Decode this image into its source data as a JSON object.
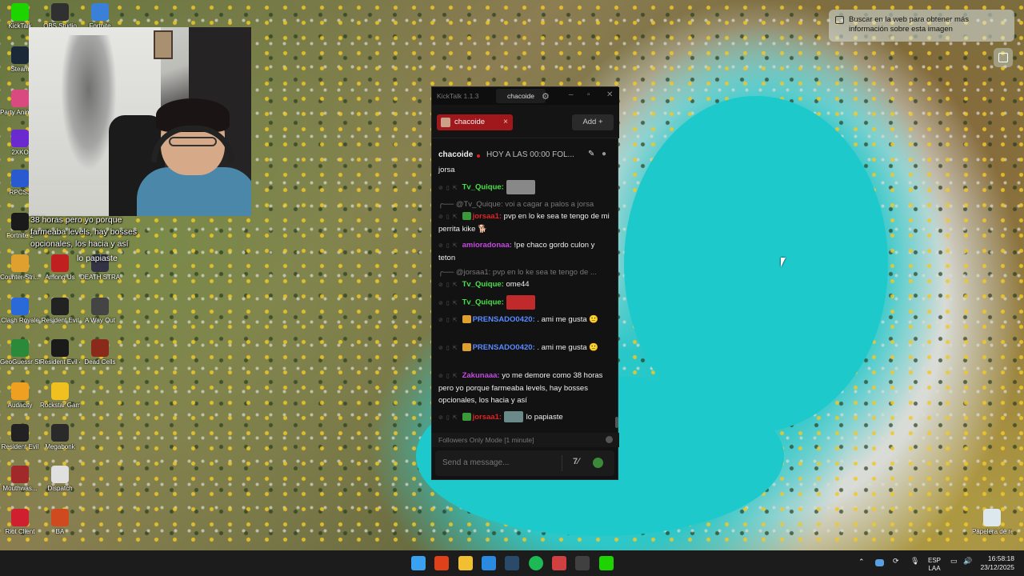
{
  "desktop": {
    "icons": [
      {
        "label": "KickTalk",
        "color": "#1ed400"
      },
      {
        "label": "OBS Studio",
        "color": "#303030"
      },
      {
        "label": "Fortnite",
        "color": "#3a7fd8"
      },
      {
        "label": "Steam",
        "color": "#1b2838"
      },
      {
        "label": "Party Anima...",
        "color": "#d84a80"
      },
      {
        "label": "2XKO",
        "color": "#6a2ad0"
      },
      {
        "label": "RPCS3",
        "color": "#2a5ad0"
      },
      {
        "label": "Fortnite 2",
        "color": "#1a1a1a"
      },
      {
        "label": "Counter-Stri...",
        "color": "#e0a030"
      },
      {
        "label": "Among Us",
        "color": "#c02020"
      },
      {
        "label": "DEATH STRANDI...",
        "color": "#333344"
      },
      {
        "label": "Clash Royale",
        "color": "#2a6ad8"
      },
      {
        "label": "Resident Evil",
        "color": "#222222"
      },
      {
        "label": "A Way Out",
        "color": "#444444"
      },
      {
        "label": "GeoGuessr Steam E...",
        "color": "#2a8a3a"
      },
      {
        "label": "Resident Evil 4",
        "color": "#1a1a1a"
      },
      {
        "label": "Dead Cells",
        "color": "#8a2a1a"
      },
      {
        "label": "Audacity",
        "color": "#f0a020"
      },
      {
        "label": "Rockstar Games...",
        "color": "#f0c020"
      },
      {
        "label": "Resident Evil",
        "color": "#222222"
      },
      {
        "label": "Megabonk",
        "color": "#2a2a2a"
      },
      {
        "label": "Mouthwas...",
        "color": "#a02a2a"
      },
      {
        "label": "Dispatch",
        "color": "#e0e0e0"
      },
      {
        "label": "Riot Client",
        "color": "#d02030"
      },
      {
        "label": "BA",
        "color": "#d04a20"
      },
      {
        "label": "Papelera de reciclaje",
        "color": "#dde8ee"
      }
    ]
  },
  "stream_overlay": {
    "caption": "38 horas pero yo porque farmeaba levels, hay bosses opcionales, los hacia y así",
    "caption2": "lo papiaste"
  },
  "lens_hint": {
    "text": "Buscar en la web para obtener más información sobre esta imagen"
  },
  "kicktalk": {
    "app_title": "KickTalk 1.1.3",
    "current_user": "chacoide",
    "tab": {
      "label": "chacoide",
      "close": "×"
    },
    "add_button": "Add",
    "channel": {
      "name": "chacoide",
      "stream_title": "HOY A LAS 00:00 FOL...",
      "pin_icon": "pin-icon",
      "users_icon": "user-icon"
    },
    "messages": [
      {
        "type": "text",
        "text": "jorsa"
      },
      {
        "type": "chat",
        "user": "Tv_Quique:",
        "user_color": "#4ae04a",
        "text": "",
        "emote": true,
        "emote_color": "#888"
      },
      {
        "type": "reply",
        "text": "@Tv_Quique: voi a cagar a palos a jorsa"
      },
      {
        "type": "chat",
        "user": "jorsaa1:",
        "user_color": "#e02424",
        "badge_color": "#3a9a3a",
        "text": "pvp en lo ke sea te tengo de mi perrita kike 🐕"
      },
      {
        "type": "chat",
        "user": "amioradonaa:",
        "user_color": "#c24ae0",
        "text": "!pe chaco gordo culon y teton"
      },
      {
        "type": "reply",
        "text": "@jorsaa1: pvp en lo ke sea te tengo de ..."
      },
      {
        "type": "chat",
        "user": "Tv_Quique:",
        "user_color": "#4ae04a",
        "text": "ome44"
      },
      {
        "type": "chat",
        "user": "Tv_Quique:",
        "user_color": "#4ae04a",
        "text": "",
        "emote": true,
        "emote_color": "#c02a2a"
      },
      {
        "type": "chat",
        "user": "PRENSADO0420:",
        "user_color": "#5a8aff",
        "badge_color": "#e0a030",
        "text": ". ami me gusta 🙂"
      },
      {
        "type": "chat",
        "user": "PRENSADO0420:",
        "user_color": "#5a8aff",
        "badge_color": "#e0a030",
        "text": ". ami me gusta 🙂"
      },
      {
        "type": "chat",
        "user": "Zakunaaa:",
        "user_color": "#c24ae0",
        "text": "yo me demore como 38 horas pero yo porque farmeaba levels, hay bosses opcionales, los hacia y así"
      },
      {
        "type": "chat",
        "user": "jorsaa1:",
        "user_color": "#e02424",
        "badge_color": "#3a9a3a",
        "text": "lo papiaste",
        "emote": true,
        "emote_color": "#6a8a8a"
      }
    ],
    "mode_text": "Followers Only Mode [1 minute]",
    "input_placeholder": "Send a message..."
  },
  "taskbar": {
    "apps": [
      {
        "name": "windows-start-icon",
        "color": "#3aa0f0"
      },
      {
        "name": "brave-icon",
        "color": "#e0401a"
      },
      {
        "name": "file-explorer-icon",
        "color": "#f0c030"
      },
      {
        "name": "bing-icon",
        "color": "#2a8ae0"
      },
      {
        "name": "steam-icon",
        "color": "#2a4a6a"
      },
      {
        "name": "spotify-icon",
        "color": "#1db954"
      },
      {
        "name": "calendar-icon",
        "color": "#d04040"
      },
      {
        "name": "obs-icon",
        "color": "#404040"
      },
      {
        "name": "kicktalk-icon",
        "color": "#1ed400"
      }
    ],
    "language": "ESP",
    "language_sub": "LAA",
    "time": "16:58:18",
    "date": "23/12/2025"
  }
}
